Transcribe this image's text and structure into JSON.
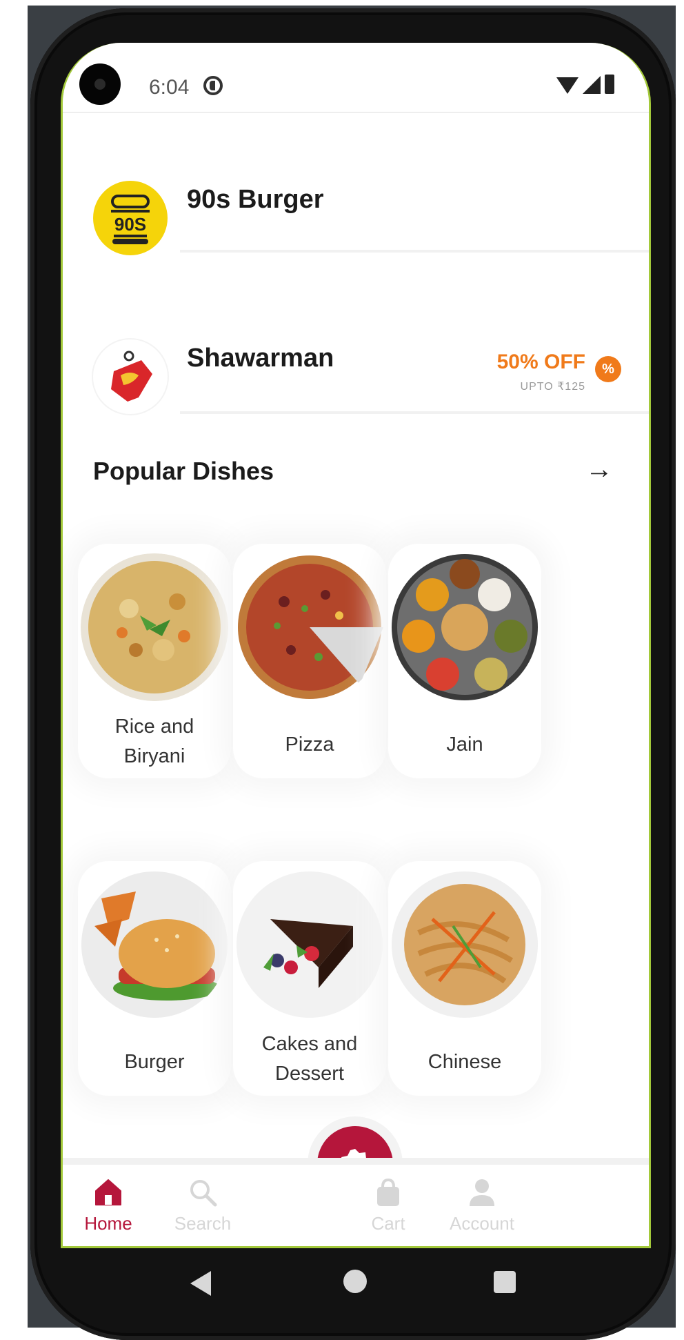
{
  "status_bar": {
    "time": "6:04"
  },
  "restaurants": [
    {
      "name": "90s Burger",
      "logo_text": "90S",
      "logo_color": "#f5d40a"
    },
    {
      "name": "Shawarman",
      "offer": {
        "title": "50% OFF",
        "subtitle": "UPTO ₹125"
      }
    }
  ],
  "popular": {
    "title": "Popular Dishes",
    "dishes": [
      {
        "label": "Rice and Biryani",
        "line1": "Rice and",
        "line2": "Biryani"
      },
      {
        "label": "Pizza"
      },
      {
        "label": "Jain"
      },
      {
        "label": "Burger"
      },
      {
        "label": "Cakes and Dessert",
        "line1": "Cakes and",
        "line2": "Dessert"
      },
      {
        "label": "Chinese"
      }
    ]
  },
  "bottom_nav": {
    "items": [
      {
        "label": "Home",
        "icon": "home-icon",
        "active": true
      },
      {
        "label": "Search",
        "icon": "search-icon"
      },
      {
        "label": "Cart",
        "icon": "cart-icon"
      },
      {
        "label": "Account",
        "icon": "account-icon"
      }
    ],
    "fab_icon": "offer-badge-icon"
  },
  "colors": {
    "brand": "#b5163b",
    "offer": "#f07a1a"
  }
}
